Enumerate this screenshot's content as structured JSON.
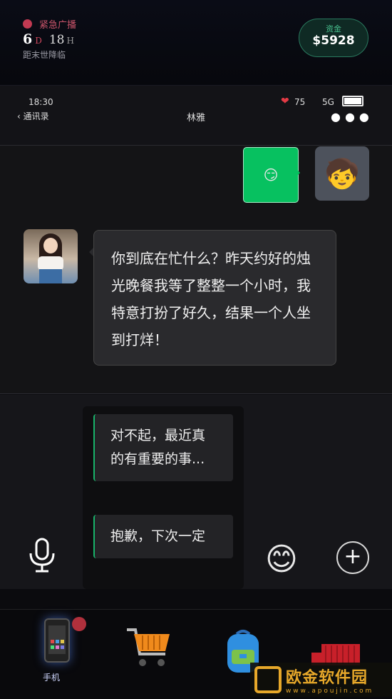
{
  "hud": {
    "alert": "紧急广播",
    "days": "6",
    "days_unit": "D",
    "hours": "18",
    "hours_unit": "H",
    "subtitle": "距末世降临",
    "money_label": "资金",
    "money_value": "$5928"
  },
  "statusbar": {
    "time": "18:30",
    "back": "通讯录",
    "title": "林雅",
    "hp": "75",
    "signal": "5G",
    "more": "●●●"
  },
  "chat": {
    "my_message": "😏",
    "her_message": "你到底在忙什么？昨天约好的烛光晚餐我等了整整一个小时，我特意打扮了好久，结果一个人坐到打烊！"
  },
  "options": [
    {
      "label": "对不起，最近真的有重要的事..."
    },
    {
      "label": "抱歉，下次一定"
    }
  ],
  "nav": {
    "phone_label": "手机"
  },
  "watermark": {
    "text": "欧金软件园",
    "url": "w w w . a p o u j i n . c o m"
  }
}
